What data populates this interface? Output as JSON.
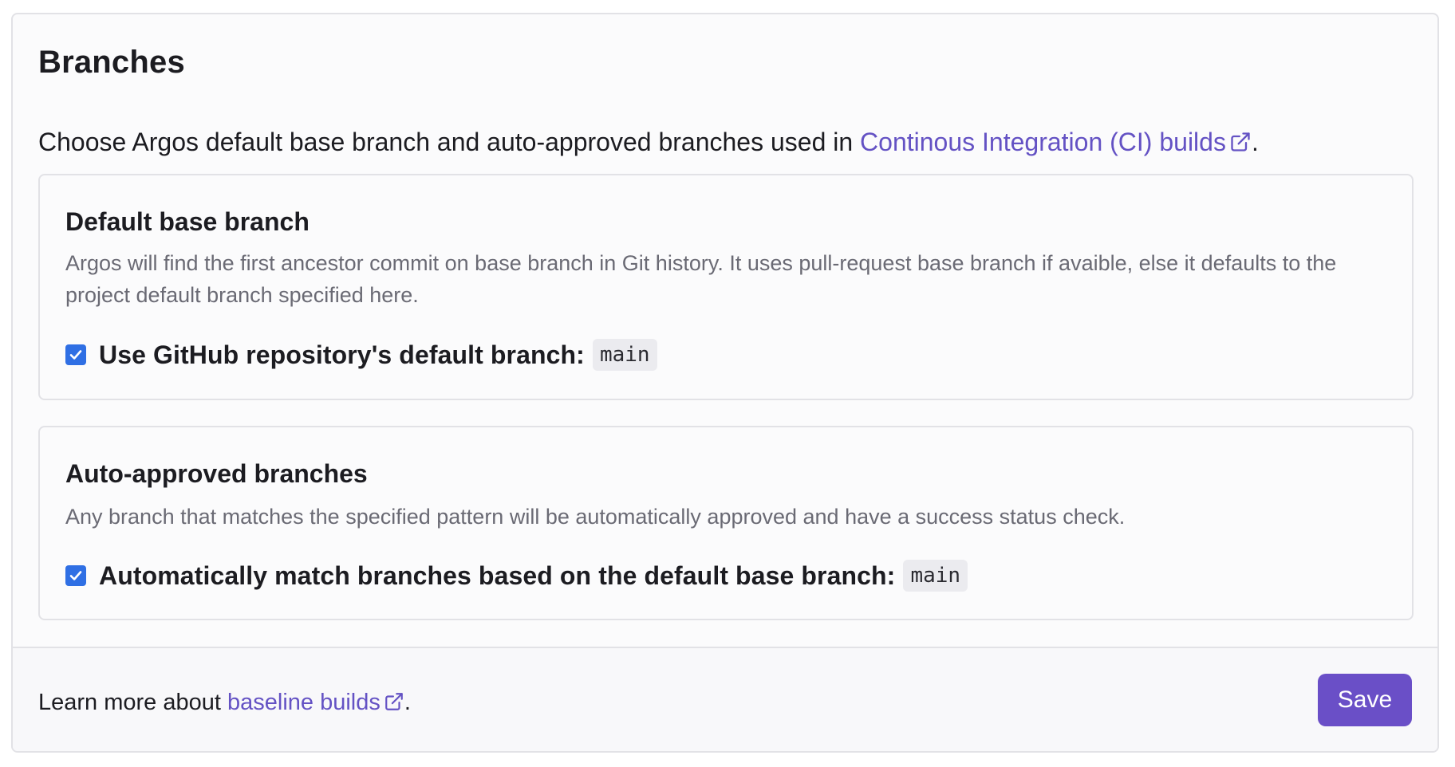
{
  "page": {
    "title": "Branches",
    "intro_text": "Choose Argos default base branch and auto-approved branches used in ",
    "intro_link": "Continous Integration (CI) builds",
    "intro_suffix": "."
  },
  "default_base_branch": {
    "title": "Default base branch",
    "description": "Argos will find the first ancestor commit on base branch in Git history. It uses pull-request base branch if avaible, else it defaults to the project default branch specified here.",
    "checkbox_label": "Use GitHub repository's default branch:",
    "checked": true,
    "branch": "main"
  },
  "auto_approved_branches": {
    "title": "Auto-approved branches",
    "description": "Any branch that matches the specified pattern will be automatically approved and have a success status check.",
    "checkbox_label": "Automatically match branches based on the default base branch:",
    "checked": true,
    "branch": "main"
  },
  "footer": {
    "text": "Learn more about ",
    "link": "baseline builds",
    "suffix": ".",
    "save_label": "Save"
  },
  "colors": {
    "accent": "#6a4fc7",
    "link": "#6452c4",
    "checkbox": "#2f6fe4"
  },
  "icons": {
    "external_link": "external-link-icon",
    "checkmark": "checkmark-icon"
  }
}
